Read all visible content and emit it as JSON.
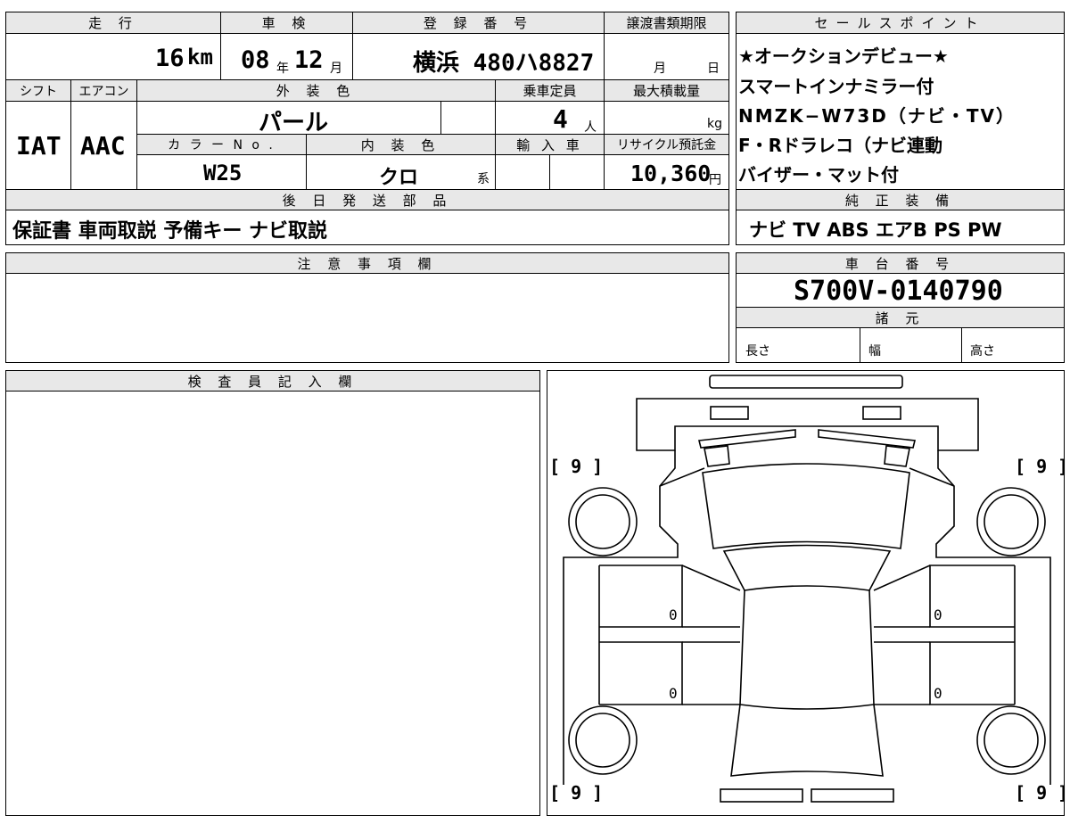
{
  "top": {
    "hdr_mileage": "走 行",
    "hdr_inspection": "車 検",
    "hdr_registration": "登 録 番 号",
    "hdr_transfer_deadline": "譲渡書類期限",
    "mileage_value": "16",
    "mileage_unit": "km",
    "inspection_year": "08",
    "year_unit": "年",
    "inspection_month": "12",
    "month_unit": "月",
    "registration_number": "横浜 480ハ8827",
    "deadline_month_unit": "月",
    "deadline_day_unit": "日"
  },
  "row2": {
    "hdr_shift": "シフト",
    "hdr_aircon": "エアコン",
    "hdr_exterior": "外 装 色",
    "hdr_capacity": "乗車定員",
    "hdr_max_load": "最大積載量",
    "shift_value": "IAT",
    "aircon_value": "AAC",
    "exterior_value": "パール",
    "capacity_value": "4",
    "capacity_unit": "人",
    "load_unit": "kg",
    "hdr_color_no": "カ ラ ー N o .",
    "hdr_interior": "内 装 色",
    "hdr_import": "輸 入 車",
    "hdr_recycle": "リサイクル預託金",
    "color_no_value": "W25",
    "interior_value": "クロ",
    "interior_suffix": "系",
    "recycle_value": "10,360",
    "recycle_unit": "円"
  },
  "later_parts": {
    "header": "後 日 発 送 部 品",
    "value": "保証書 車両取説 予備キー ナビ取説"
  },
  "sales_points": {
    "header": "セールスポイント",
    "lines": [
      "★オークションデビュー★",
      "スマートインナミラー付",
      "NMZK−W73D（ナビ・TV）",
      "F・Rドラレコ（ナビ連動",
      "バイザー・マット付"
    ]
  },
  "equipment": {
    "header": "純 正 装 備",
    "value": "ナビ TV ABS エアB PS PW"
  },
  "notes": {
    "header": "注 意 事 項 欄"
  },
  "chassis": {
    "header": "車 台 番 号",
    "value": "S700V-0140790"
  },
  "specs": {
    "header": "諸 元",
    "length_label": "長さ",
    "width_label": "幅",
    "height_label": "高さ"
  },
  "inspector": {
    "header": "検 査 員 記 入 欄"
  },
  "diagram": {
    "corner_tl": "[ 9 ]",
    "corner_tr": "[ 9 ]",
    "corner_bl": "[ 9 ]",
    "corner_br": "[ 9 ]",
    "door_fl": "0",
    "door_rl": "0",
    "door_fr": "0",
    "door_rr": "0"
  }
}
